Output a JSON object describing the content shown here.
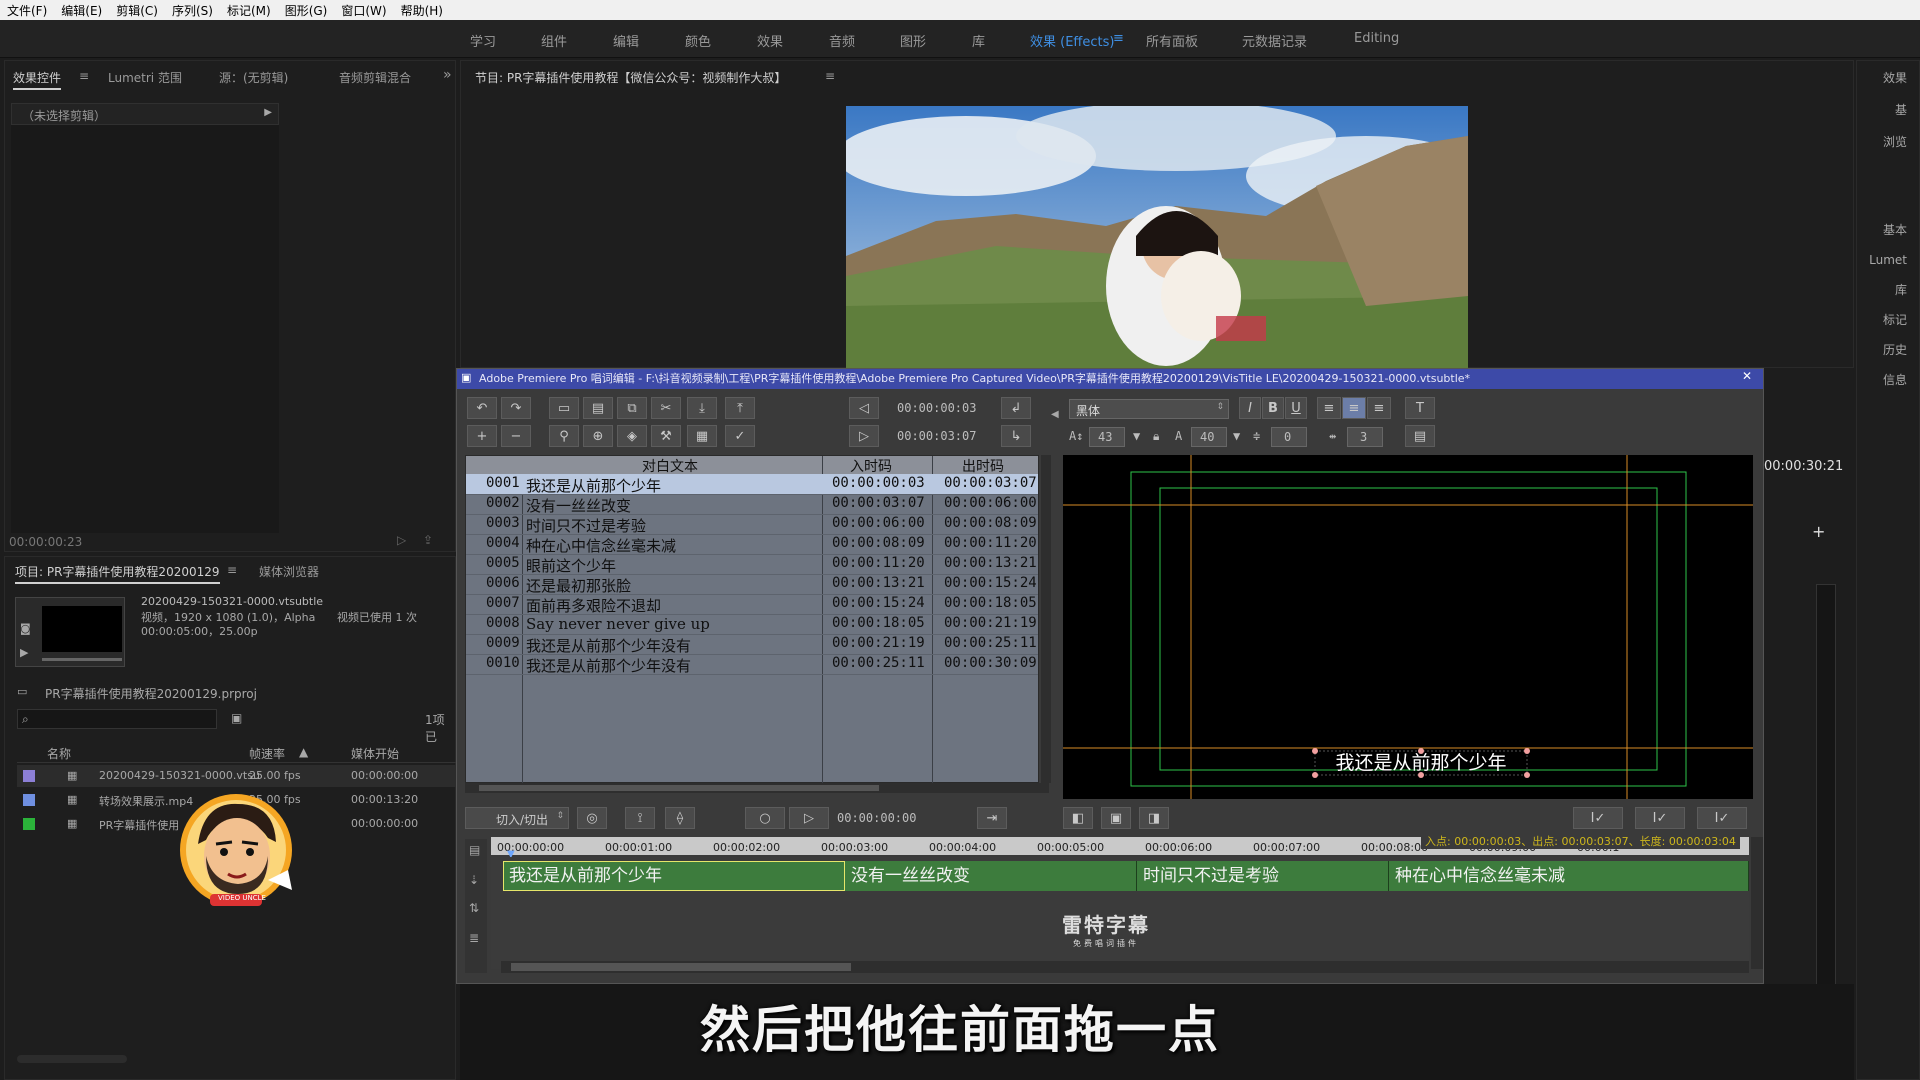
{
  "menu": [
    "文件(F)",
    "编辑(E)",
    "剪辑(C)",
    "序列(S)",
    "标记(M)",
    "图形(G)",
    "窗口(W)",
    "帮助(H)"
  ],
  "workspaces": [
    "学习",
    "组件",
    "编辑",
    "颜色",
    "效果",
    "音频",
    "图形",
    "库",
    "效果 (Effects)",
    "所有面板",
    "元数据记录",
    "Editing"
  ],
  "active_workspace": "效果 (Effects)",
  "left_panel": {
    "tabs": [
      "效果控件",
      "Lumetri 范围",
      "源：(无剪辑)",
      "音频剪辑混合"
    ],
    "no_clip": "（未选择剪辑）",
    "timecode": "00:00:00:23"
  },
  "program": {
    "title": "节目: PR字幕插件使用教程【微信公众号：视频制作大叔】"
  },
  "project": {
    "tabs": [
      "项目: PR字幕插件使用教程20200129",
      "媒体浏览器"
    ],
    "clip_name": "20200429-150321-0000.vtsubtle",
    "clip_info1": "视频，1920 x 1080 (1.0)，Alpha",
    "clip_info2": "视频已使用 1 次",
    "clip_info3": "00:00:05:00，25.00p",
    "project_file": "PR字幕插件使用教程20200129.prproj",
    "count": "1项已",
    "columns": [
      "名称",
      "帧速率",
      "媒体开始"
    ],
    "items": [
      {
        "name": "20200429-150321-0000.vtsu",
        "fps": "25.00 fps",
        "start": "00:00:00:00",
        "color": "#8c7fd6"
      },
      {
        "name": "转场效果展示.mp4",
        "fps": "25.00 fps",
        "start": "00:00:13:20",
        "color": "#6f8fe0"
      },
      {
        "name": "PR字幕插件使用",
        "fps": "",
        "start": "00:00:00:00",
        "color": "#2bb33a"
      }
    ]
  },
  "right_strip": [
    "效果",
    "基",
    "浏览",
    "基本",
    "Lumet",
    "库",
    "标记",
    "历史",
    "信息"
  ],
  "right_timecode": "00:00:30:21",
  "vistitle": {
    "window_title": "Adobe Premiere Pro 唱词编辑 - F:\\抖音视频录制\\工程\\PR字幕插件使用教程\\Adobe Premiere Pro Captured Video\\PR字幕插件使用教程20200129\\VisTitle LE\\20200429-150321-0000.vtsubtle*",
    "in_tc": "00:00:00:03",
    "out_tc": "00:00:03:07",
    "font_name": "黑体",
    "font_size": "43",
    "spacing": "40",
    "v1": "0",
    "v2": "3",
    "table_headers": {
      "text": "对白文本",
      "in": "入时码",
      "out": "出时码"
    },
    "rows": [
      {
        "num": "0001",
        "text": "我还是从前那个少年",
        "in": "00:00:00:03",
        "out": "00:00:03:07"
      },
      {
        "num": "0002",
        "text": "没有一丝丝改变",
        "in": "00:00:03:07",
        "out": "00:00:06:00"
      },
      {
        "num": "0003",
        "text": "时间只不过是考验",
        "in": "00:00:06:00",
        "out": "00:00:08:09"
      },
      {
        "num": "0004",
        "text": "种在心中信念丝毫未减",
        "in": "00:00:08:09",
        "out": "00:00:11:20"
      },
      {
        "num": "0005",
        "text": "眼前这个少年",
        "in": "00:00:11:20",
        "out": "00:00:13:21"
      },
      {
        "num": "0006",
        "text": "还是最初那张脸",
        "in": "00:00:13:21",
        "out": "00:00:15:24"
      },
      {
        "num": "0007",
        "text": "面前再多艰险不退却",
        "in": "00:00:15:24",
        "out": "00:00:18:05"
      },
      {
        "num": "0008",
        "text": "Say never never give up",
        "in": "00:00:18:05",
        "out": "00:00:21:19"
      },
      {
        "num": "0009",
        "text": "我还是从前那个少年没有",
        "in": "00:00:21:19",
        "out": "00:00:25:11"
      },
      {
        "num": "0010",
        "text": "我还是从前那个少年没有",
        "in": "00:00:25:11",
        "out": "00:00:30:09"
      }
    ],
    "preview_text": "我还是从前那个少年",
    "mode_select": "切入/切出",
    "play_tc": "00:00:00:00",
    "range_info": "入点: 00:00:00:03、出点: 00:00:03:07、长度: 00:00:03:04",
    "ruler": [
      "00:00:00:00",
      "00:00:01:00",
      "00:00:02:00",
      "00:00:03:00",
      "00:00:04:00",
      "00:00:05:00",
      "00:00:06:00",
      "00:00:07:00",
      "00:00:08:00",
      "00:00:09:00",
      "00:00:1"
    ],
    "segments": [
      "我还是从前那个少年",
      "没有一丝丝改变",
      "时间只不过是考验",
      "种在心中信念丝毫未减"
    ],
    "logo_line1": "雷特字幕",
    "logo_line2": "免费唱词插件"
  },
  "avatar_text": "VIDEO UNCLE",
  "subtitle": "然后把他往前面拖一点"
}
